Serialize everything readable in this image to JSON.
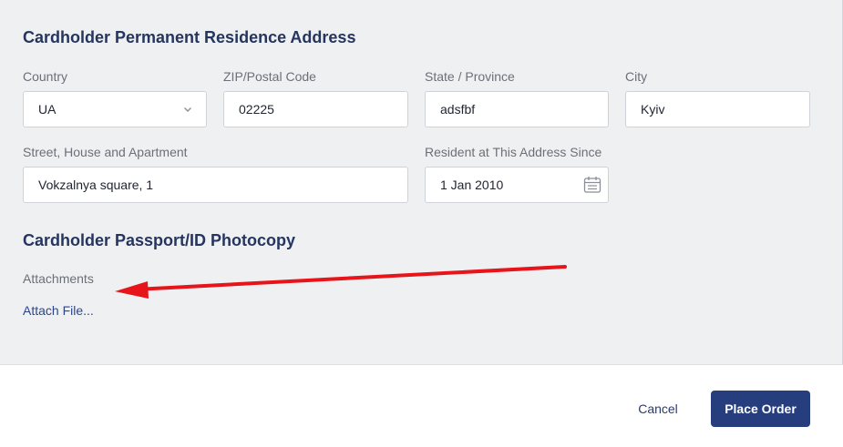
{
  "residence": {
    "title": "Cardholder Permanent Residence Address",
    "country": {
      "label": "Country",
      "value": "UA"
    },
    "zip": {
      "label": "ZIP/Postal Code",
      "value": "02225"
    },
    "state": {
      "label": "State / Province",
      "value": "adsfbf"
    },
    "city": {
      "label": "City",
      "value": "Kyiv"
    },
    "street": {
      "label": "Street, House and Apartment",
      "value": "Vokzalnya square, 1"
    },
    "since": {
      "label": "Resident at This Address Since",
      "value": "1 Jan 2010"
    }
  },
  "passport": {
    "title": "Cardholder Passport/ID Photocopy",
    "attachments_label": "Attachments",
    "attach_link": "Attach File..."
  },
  "footer": {
    "cancel_label": "Cancel",
    "place_order_label": "Place Order"
  },
  "icons": {
    "country_dropdown": "chevron-down-icon",
    "date_picker": "calendar-icon",
    "annotation": "red-arrow-annotation"
  },
  "colors": {
    "heading": "#25355f",
    "primary_button": "#263e7d",
    "link": "#2b4690",
    "annotation_arrow": "#e8141b"
  }
}
